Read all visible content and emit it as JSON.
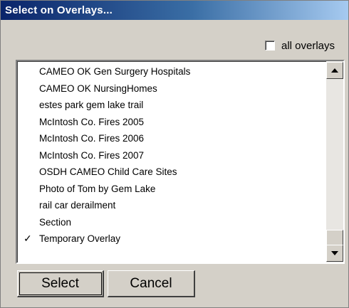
{
  "window": {
    "title": "Select on Overlays..."
  },
  "all_overlays": {
    "label": "all overlays",
    "checked": false
  },
  "overlay_list": {
    "items": [
      {
        "label": "CAMEO OK Gen Surgery Hospitals",
        "checked": false
      },
      {
        "label": "CAMEO OK NursingHomes",
        "checked": false
      },
      {
        "label": "estes park gem lake trail",
        "checked": false
      },
      {
        "label": "McIntosh Co. Fires 2005",
        "checked": false
      },
      {
        "label": "McIntosh Co. Fires 2006",
        "checked": false
      },
      {
        "label": "McIntosh Co. Fires 2007",
        "checked": false
      },
      {
        "label": "OSDH CAMEO Child Care Sites",
        "checked": false
      },
      {
        "label": "Photo of Tom by Gem Lake",
        "checked": false
      },
      {
        "label": "rail car derailment",
        "checked": false
      },
      {
        "label": "Section",
        "checked": false
      },
      {
        "label": "Temporary Overlay",
        "checked": true
      }
    ],
    "check_glyph": "✓"
  },
  "buttons": {
    "select": "Select",
    "cancel": "Cancel"
  },
  "colors": {
    "title_bar_start": "#0a246a",
    "title_bar_end": "#a6caf0",
    "face": "#d4d0c8"
  }
}
